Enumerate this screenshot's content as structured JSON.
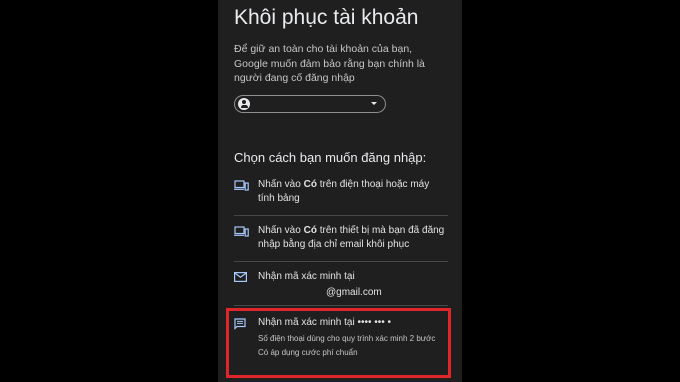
{
  "screen": {
    "title": "Khôi phục tài khoản",
    "description": "Để giữ an toàn cho tài khoản của bạn, Google muốn đảm bảo rằng bạn chính là người đang cố đăng nhập",
    "account_chip": {
      "email": "",
      "avatar_icon": "account-circle-icon",
      "dropdown_icon": "chevron-down-icon"
    },
    "choose_heading": "Chọn cách bạn muốn đăng nhập:",
    "options": [
      {
        "icon": "devices-icon",
        "text_before": "Nhấn vào ",
        "text_bold": "Có",
        "text_after": " trên điện thoại hoặc máy tính bảng"
      },
      {
        "icon": "devices-icon",
        "text_before": "Nhấn vào ",
        "text_bold": "Có",
        "text_after": " trên thiết bị mà bạn đã đăng nhập bằng địa chỉ email khôi phục"
      },
      {
        "icon": "mail-icon",
        "label": "Nhận mã xác minh tại",
        "email": "@gmail.com"
      },
      {
        "icon": "sms-icon",
        "label": "Nhận mã xác minh tại •••• ••• •",
        "subtext_1": "Số điện thoại dùng cho quy trình xác minh 2 bước",
        "subtext_2": "Có áp dụng cước phí chuẩn"
      }
    ],
    "highlight_color": "#e0252b"
  }
}
